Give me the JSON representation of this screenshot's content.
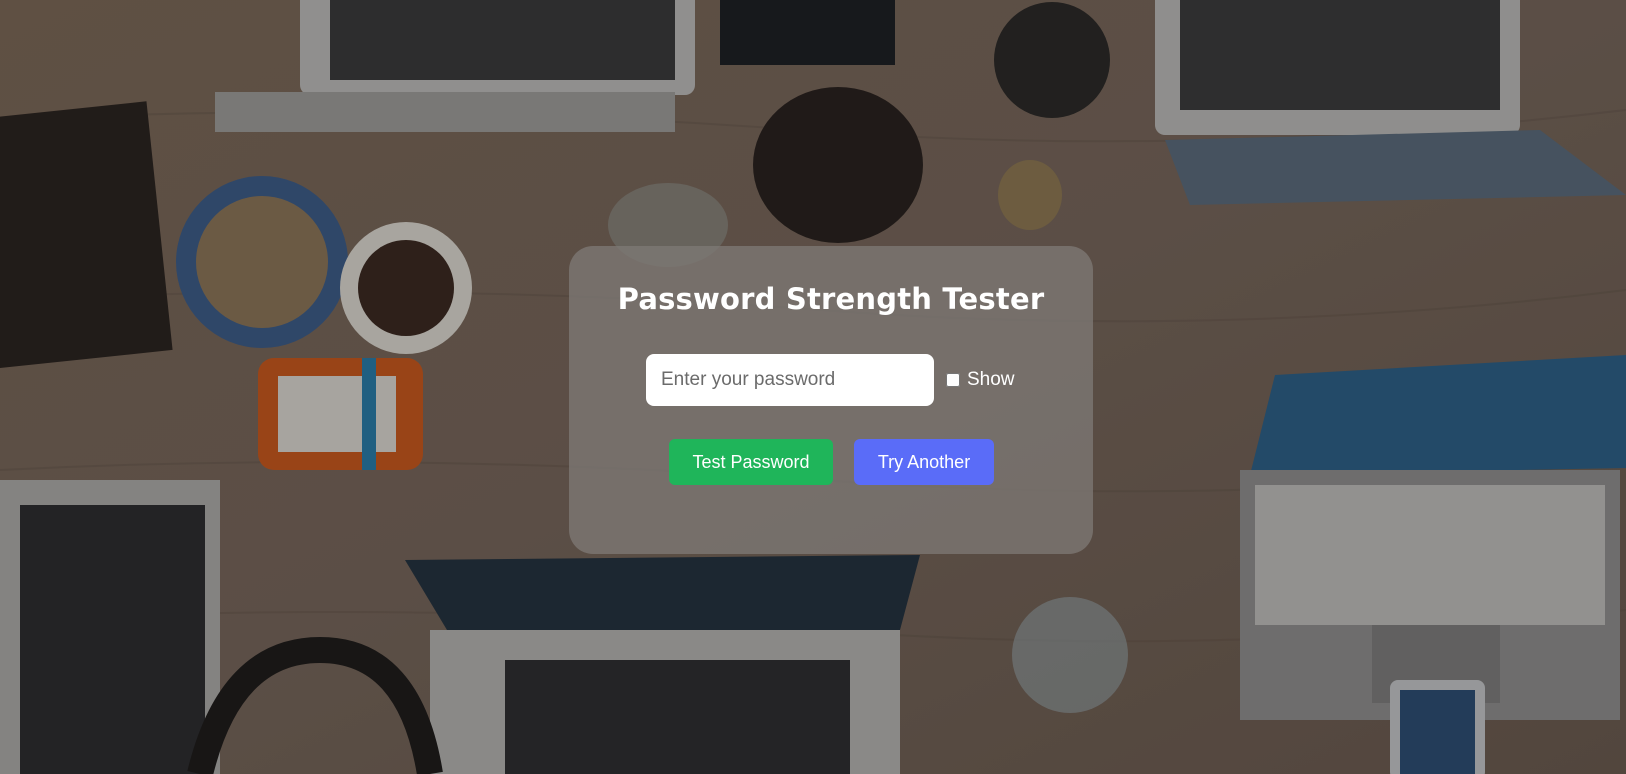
{
  "card": {
    "title": "Password Strength Tester"
  },
  "password_field": {
    "value": "",
    "placeholder": "Enter your password"
  },
  "show_toggle": {
    "label": "Show",
    "checked": false
  },
  "buttons": {
    "test_label": "Test Password",
    "another_label": "Try Another"
  },
  "colors": {
    "test_button": "#1fb55a",
    "another_button": "#5a6cf8",
    "card_overlay": "#7d7874"
  }
}
